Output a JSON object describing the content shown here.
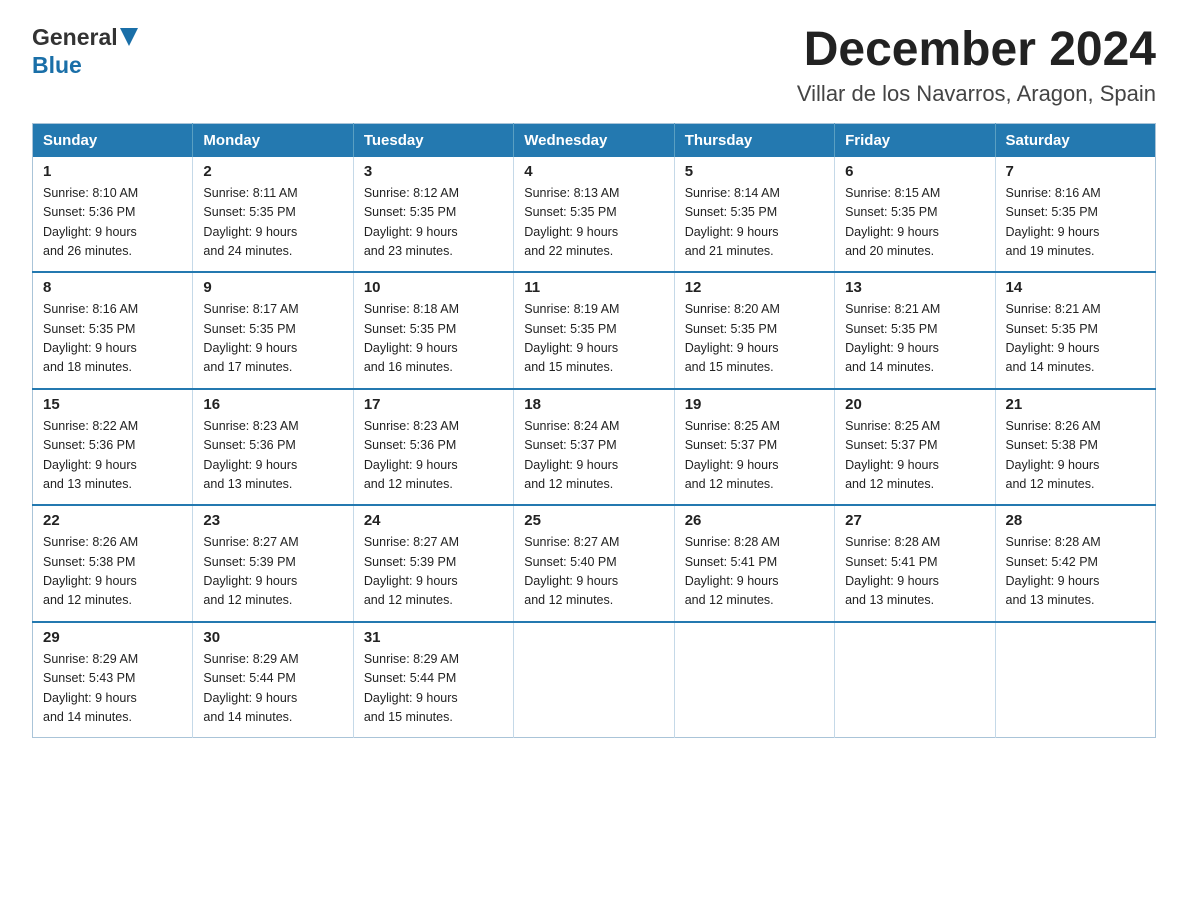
{
  "logo": {
    "line1": "General",
    "line2": "Blue"
  },
  "title": "December 2024",
  "subtitle": "Villar de los Navarros, Aragon, Spain",
  "days_of_week": [
    "Sunday",
    "Monday",
    "Tuesday",
    "Wednesday",
    "Thursday",
    "Friday",
    "Saturday"
  ],
  "weeks": [
    [
      {
        "day": "1",
        "sunrise": "8:10 AM",
        "sunset": "5:36 PM",
        "daylight": "9 hours and 26 minutes."
      },
      {
        "day": "2",
        "sunrise": "8:11 AM",
        "sunset": "5:35 PM",
        "daylight": "9 hours and 24 minutes."
      },
      {
        "day": "3",
        "sunrise": "8:12 AM",
        "sunset": "5:35 PM",
        "daylight": "9 hours and 23 minutes."
      },
      {
        "day": "4",
        "sunrise": "8:13 AM",
        "sunset": "5:35 PM",
        "daylight": "9 hours and 22 minutes."
      },
      {
        "day": "5",
        "sunrise": "8:14 AM",
        "sunset": "5:35 PM",
        "daylight": "9 hours and 21 minutes."
      },
      {
        "day": "6",
        "sunrise": "8:15 AM",
        "sunset": "5:35 PM",
        "daylight": "9 hours and 20 minutes."
      },
      {
        "day": "7",
        "sunrise": "8:16 AM",
        "sunset": "5:35 PM",
        "daylight": "9 hours and 19 minutes."
      }
    ],
    [
      {
        "day": "8",
        "sunrise": "8:16 AM",
        "sunset": "5:35 PM",
        "daylight": "9 hours and 18 minutes."
      },
      {
        "day": "9",
        "sunrise": "8:17 AM",
        "sunset": "5:35 PM",
        "daylight": "9 hours and 17 minutes."
      },
      {
        "day": "10",
        "sunrise": "8:18 AM",
        "sunset": "5:35 PM",
        "daylight": "9 hours and 16 minutes."
      },
      {
        "day": "11",
        "sunrise": "8:19 AM",
        "sunset": "5:35 PM",
        "daylight": "9 hours and 15 minutes."
      },
      {
        "day": "12",
        "sunrise": "8:20 AM",
        "sunset": "5:35 PM",
        "daylight": "9 hours and 15 minutes."
      },
      {
        "day": "13",
        "sunrise": "8:21 AM",
        "sunset": "5:35 PM",
        "daylight": "9 hours and 14 minutes."
      },
      {
        "day": "14",
        "sunrise": "8:21 AM",
        "sunset": "5:35 PM",
        "daylight": "9 hours and 14 minutes."
      }
    ],
    [
      {
        "day": "15",
        "sunrise": "8:22 AM",
        "sunset": "5:36 PM",
        "daylight": "9 hours and 13 minutes."
      },
      {
        "day": "16",
        "sunrise": "8:23 AM",
        "sunset": "5:36 PM",
        "daylight": "9 hours and 13 minutes."
      },
      {
        "day": "17",
        "sunrise": "8:23 AM",
        "sunset": "5:36 PM",
        "daylight": "9 hours and 12 minutes."
      },
      {
        "day": "18",
        "sunrise": "8:24 AM",
        "sunset": "5:37 PM",
        "daylight": "9 hours and 12 minutes."
      },
      {
        "day": "19",
        "sunrise": "8:25 AM",
        "sunset": "5:37 PM",
        "daylight": "9 hours and 12 minutes."
      },
      {
        "day": "20",
        "sunrise": "8:25 AM",
        "sunset": "5:37 PM",
        "daylight": "9 hours and 12 minutes."
      },
      {
        "day": "21",
        "sunrise": "8:26 AM",
        "sunset": "5:38 PM",
        "daylight": "9 hours and 12 minutes."
      }
    ],
    [
      {
        "day": "22",
        "sunrise": "8:26 AM",
        "sunset": "5:38 PM",
        "daylight": "9 hours and 12 minutes."
      },
      {
        "day": "23",
        "sunrise": "8:27 AM",
        "sunset": "5:39 PM",
        "daylight": "9 hours and 12 minutes."
      },
      {
        "day": "24",
        "sunrise": "8:27 AM",
        "sunset": "5:39 PM",
        "daylight": "9 hours and 12 minutes."
      },
      {
        "day": "25",
        "sunrise": "8:27 AM",
        "sunset": "5:40 PM",
        "daylight": "9 hours and 12 minutes."
      },
      {
        "day": "26",
        "sunrise": "8:28 AM",
        "sunset": "5:41 PM",
        "daylight": "9 hours and 12 minutes."
      },
      {
        "day": "27",
        "sunrise": "8:28 AM",
        "sunset": "5:41 PM",
        "daylight": "9 hours and 13 minutes."
      },
      {
        "day": "28",
        "sunrise": "8:28 AM",
        "sunset": "5:42 PM",
        "daylight": "9 hours and 13 minutes."
      }
    ],
    [
      {
        "day": "29",
        "sunrise": "8:29 AM",
        "sunset": "5:43 PM",
        "daylight": "9 hours and 14 minutes."
      },
      {
        "day": "30",
        "sunrise": "8:29 AM",
        "sunset": "5:44 PM",
        "daylight": "9 hours and 14 minutes."
      },
      {
        "day": "31",
        "sunrise": "8:29 AM",
        "sunset": "5:44 PM",
        "daylight": "9 hours and 15 minutes."
      },
      null,
      null,
      null,
      null
    ]
  ],
  "labels": {
    "sunrise": "Sunrise:",
    "sunset": "Sunset:",
    "daylight": "Daylight: 9 hours"
  }
}
